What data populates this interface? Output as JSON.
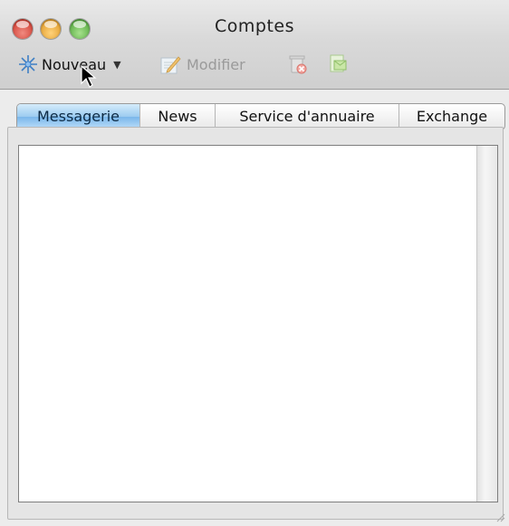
{
  "window": {
    "title": "Comptes"
  },
  "toolbar": {
    "new_label": "Nouveau",
    "edit_label": "Modifier",
    "icons": {
      "new": "star-icon",
      "new_menu": "caret-down-icon",
      "edit": "edit-icon",
      "delete": "trash-icon",
      "send": "send-receive-icon"
    }
  },
  "tabs": [
    {
      "label": "Messagerie",
      "active": true
    },
    {
      "label": "News",
      "active": false
    },
    {
      "label": "Service d'annuaire",
      "active": false
    },
    {
      "label": "Exchange",
      "active": false
    }
  ],
  "colors": {
    "active_tab": "#9ccbf0",
    "close": "#c9291d",
    "minimize": "#d88c12",
    "zoom": "#3f9b2a"
  }
}
